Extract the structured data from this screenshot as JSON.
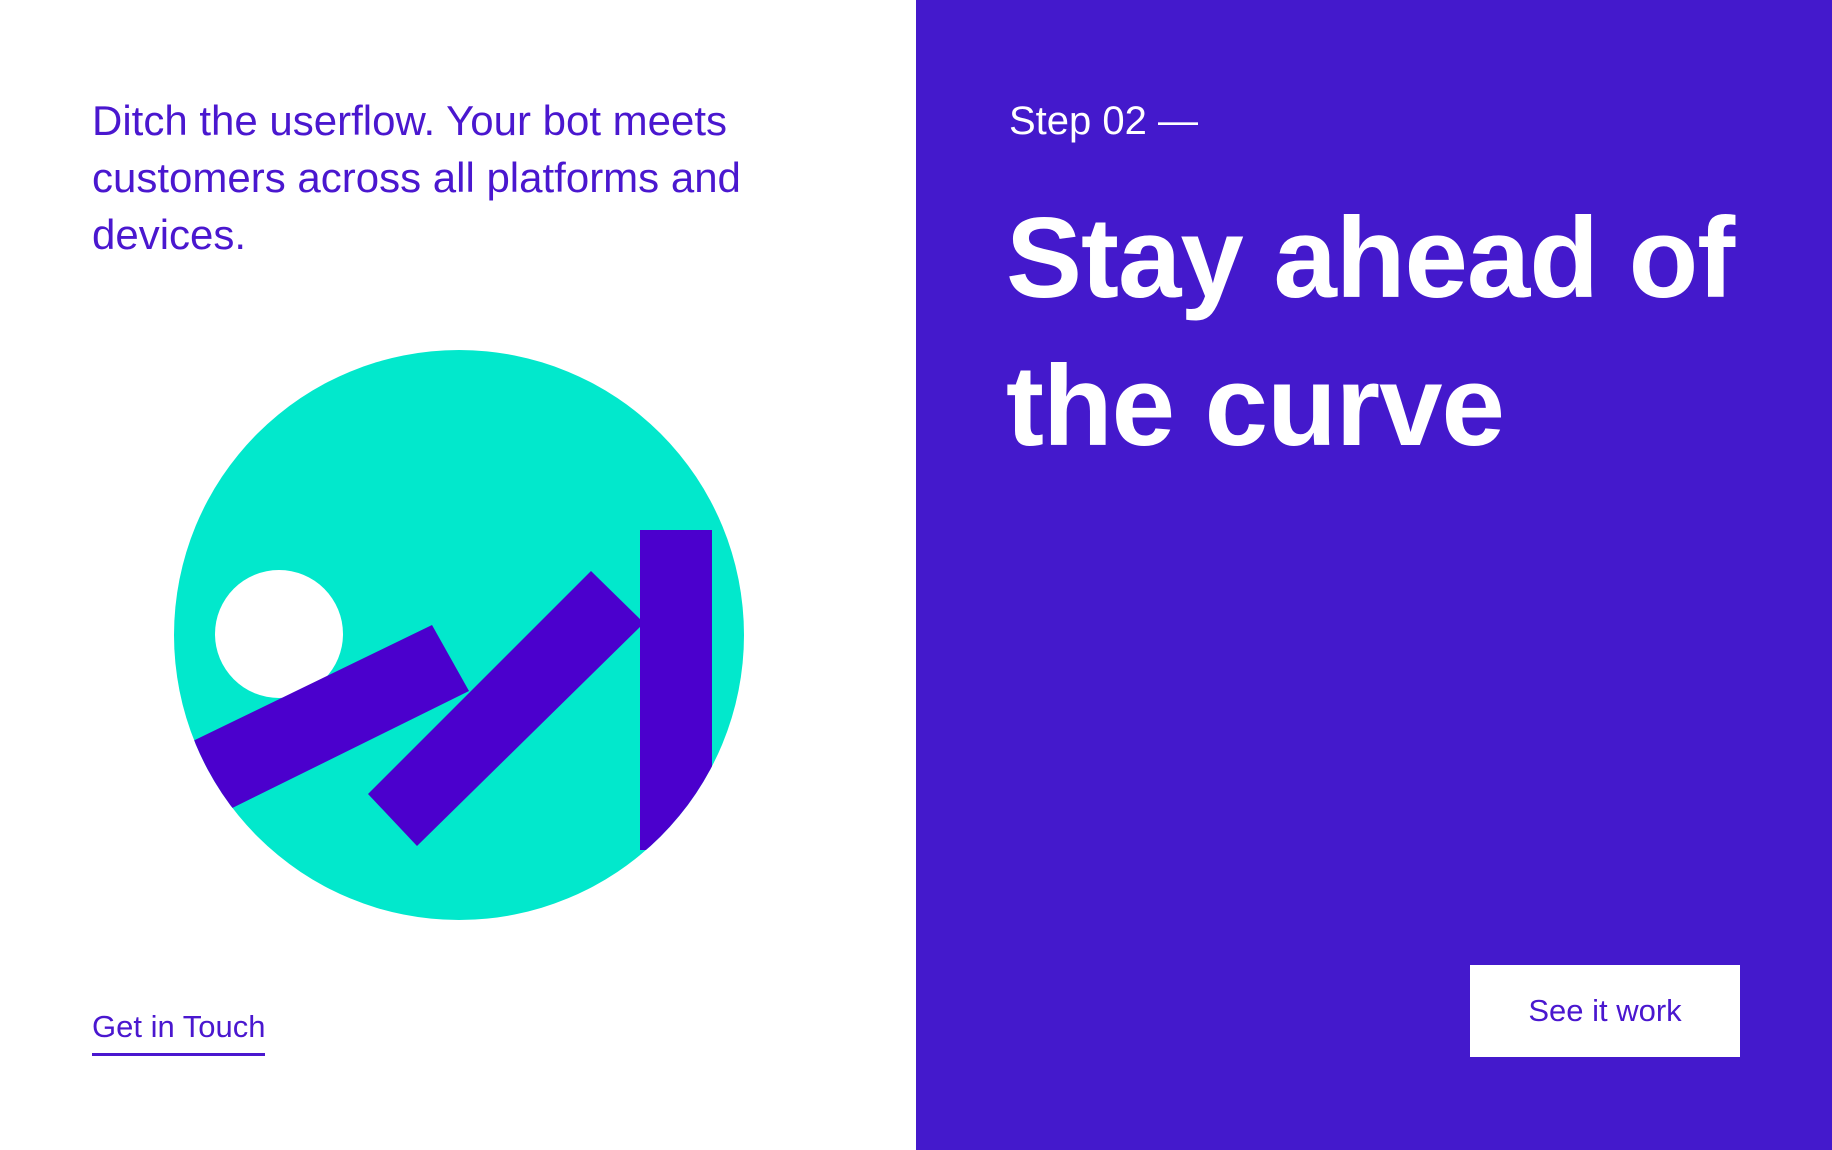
{
  "intro": {
    "text": "Ditch the userflow. Your bot meets customers across all platforms and devices."
  },
  "links": {
    "get_in_touch": "Get in Touch"
  },
  "step": {
    "label": "Step 02 —",
    "headline": "Stay ahead of the curve"
  },
  "cta": {
    "label": "See it work"
  },
  "colors": {
    "brand_purple": "#4419cc",
    "accent_purple": "#4a17cf",
    "mint": "#02e8cc",
    "white": "#ffffff"
  },
  "illustration": {
    "icon": "abstract-rising-bars-illustration"
  }
}
